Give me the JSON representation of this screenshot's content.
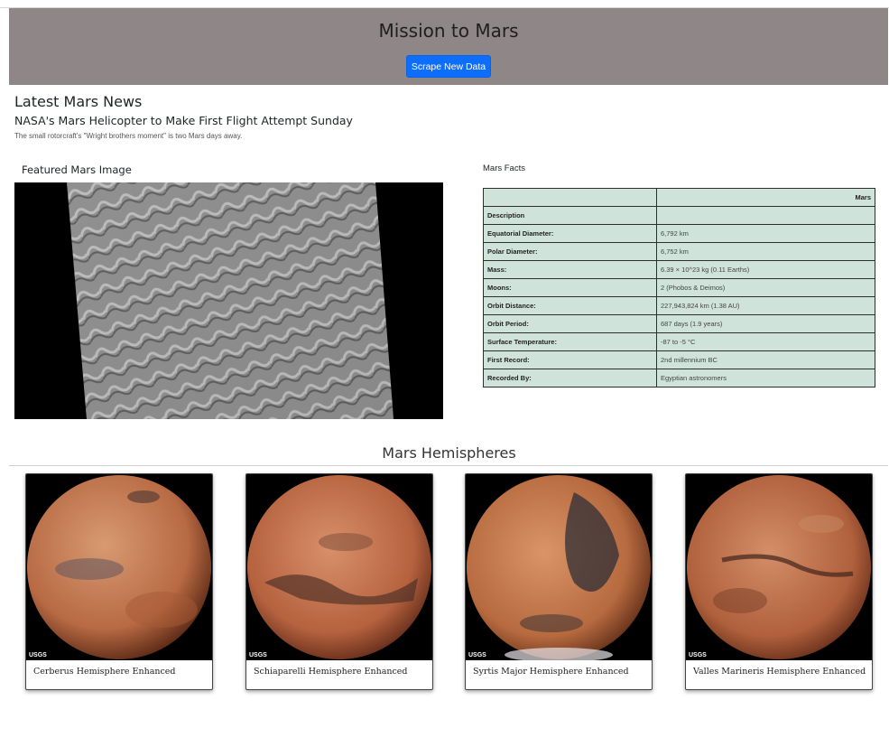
{
  "header": {
    "title": "Mission to Mars",
    "button_label": "Scrape New Data"
  },
  "news": {
    "section_title": "Latest Mars News",
    "headline": "NASA's Mars Helicopter to Make First Flight Attempt Sunday",
    "teaser": "The small rotorcraft's \"Wright brothers moment\" is two Mars days away."
  },
  "featured": {
    "title": "Featured Mars Image"
  },
  "facts": {
    "title": "Mars Facts",
    "column_header": "Mars",
    "rows": [
      {
        "label": "Description",
        "value": ""
      },
      {
        "label": "Equatorial Diameter:",
        "value": "6,792 km"
      },
      {
        "label": "Polar Diameter:",
        "value": "6,752 km"
      },
      {
        "label": "Mass:",
        "value": "6.39 × 10^23 kg (0.11 Earths)"
      },
      {
        "label": "Moons:",
        "value": "2 (Phobos & Deimos)"
      },
      {
        "label": "Orbit Distance:",
        "value": "227,943,824 km (1.38 AU)"
      },
      {
        "label": "Orbit Period:",
        "value": "687 days (1.9 years)"
      },
      {
        "label": "Surface Temperature:",
        "value": "-87 to -5 °C"
      },
      {
        "label": "First Record:",
        "value": "2nd millennium BC"
      },
      {
        "label": "Recorded By:",
        "value": "Egyptian astronomers"
      }
    ]
  },
  "hemispheres": {
    "title": "Mars Hemispheres",
    "logo_text": "USGS",
    "items": [
      {
        "title": "Cerberus Hemisphere Enhanced"
      },
      {
        "title": "Schiaparelli Hemisphere Enhanced"
      },
      {
        "title": "Syrtis Major Hemisphere Enhanced"
      },
      {
        "title": "Valles Marineris Hemisphere Enhanced"
      }
    ]
  },
  "colors": {
    "header_bg": "#8e8687",
    "button": "#0d6efd",
    "table_bg": "#d0e3db"
  }
}
